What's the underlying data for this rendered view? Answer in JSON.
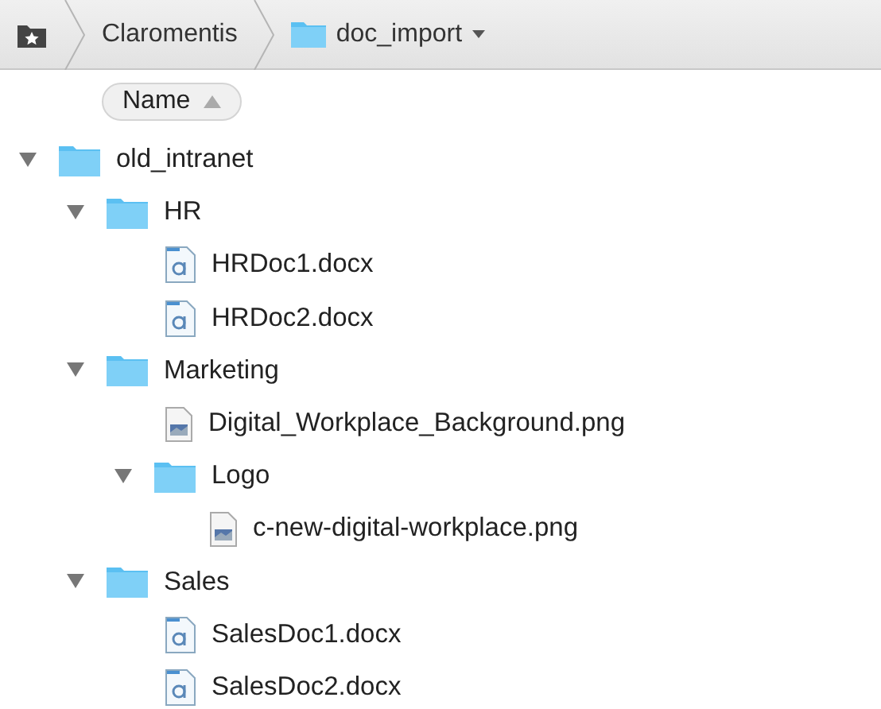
{
  "path_bar": {
    "items": [
      {
        "kind": "root"
      },
      {
        "kind": "item",
        "label": "Claromentis"
      },
      {
        "kind": "folder",
        "label": "doc_import"
      }
    ]
  },
  "header": {
    "label": "Name",
    "sort_ascending": true
  },
  "tree": [
    {
      "kind": "folder",
      "name": "old_intranet",
      "expanded": true,
      "children": [
        {
          "kind": "folder",
          "name": "HR",
          "expanded": true,
          "children": [
            {
              "kind": "document",
              "name": "HRDoc1.docx"
            },
            {
              "kind": "document",
              "name": "HRDoc2.docx"
            }
          ]
        },
        {
          "kind": "folder",
          "name": "Marketing",
          "expanded": true,
          "children": [
            {
              "kind": "image",
              "name": "Digital_Workplace_Background.png"
            },
            {
              "kind": "folder",
              "name": "Logo",
              "expanded": true,
              "children": [
                {
                  "kind": "image",
                  "name": "c-new-digital-workplace.png"
                }
              ]
            }
          ]
        },
        {
          "kind": "folder",
          "name": "Sales",
          "expanded": true,
          "children": [
            {
              "kind": "document",
              "name": "SalesDoc1.docx"
            },
            {
              "kind": "document",
              "name": "SalesDoc2.docx"
            }
          ]
        }
      ]
    }
  ]
}
